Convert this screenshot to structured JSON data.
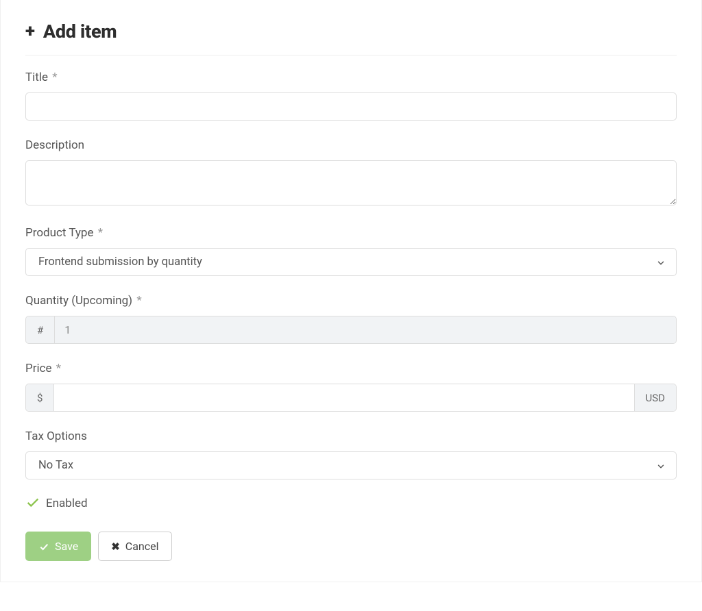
{
  "header": {
    "title": "Add item"
  },
  "fields": {
    "title": {
      "label": "Title",
      "required": "*",
      "value": ""
    },
    "description": {
      "label": "Description",
      "value": ""
    },
    "productType": {
      "label": "Product Type",
      "required": "*",
      "selected": "Frontend submission by quantity"
    },
    "quantity": {
      "label": "Quantity (Upcoming)",
      "required": "*",
      "prefix": "#",
      "value": "1"
    },
    "price": {
      "label": "Price",
      "required": "*",
      "prefix": "$",
      "suffix": "USD",
      "value": ""
    },
    "taxOptions": {
      "label": "Tax Options",
      "selected": "No Tax"
    },
    "enabled": {
      "label": "Enabled",
      "checked": true
    }
  },
  "buttons": {
    "save": "Save",
    "cancel": "Cancel"
  }
}
